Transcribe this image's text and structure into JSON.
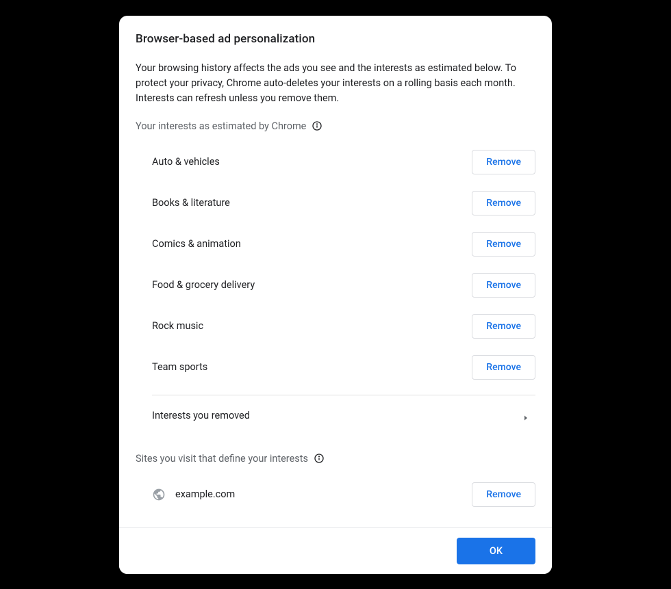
{
  "dialog": {
    "title": "Browser-based ad personalization",
    "description": "Your browsing history affects the ads you see and the interests as estimated below. To protect your privacy, Chrome auto-deletes your interests on a rolling basis each month. Interests can refresh unless you remove them.",
    "interests_label": "Your interests as estimated by Chrome",
    "sites_label": "Sites you visit that define your interests",
    "removed_label": "Interests you removed",
    "remove_button": "Remove",
    "ok_button": "OK"
  },
  "interests": [
    {
      "name": "Auto & vehicles"
    },
    {
      "name": "Books & literature"
    },
    {
      "name": "Comics & animation"
    },
    {
      "name": "Food & grocery delivery"
    },
    {
      "name": "Rock music"
    },
    {
      "name": "Team sports"
    }
  ],
  "sites": [
    {
      "name": "example.com"
    }
  ]
}
